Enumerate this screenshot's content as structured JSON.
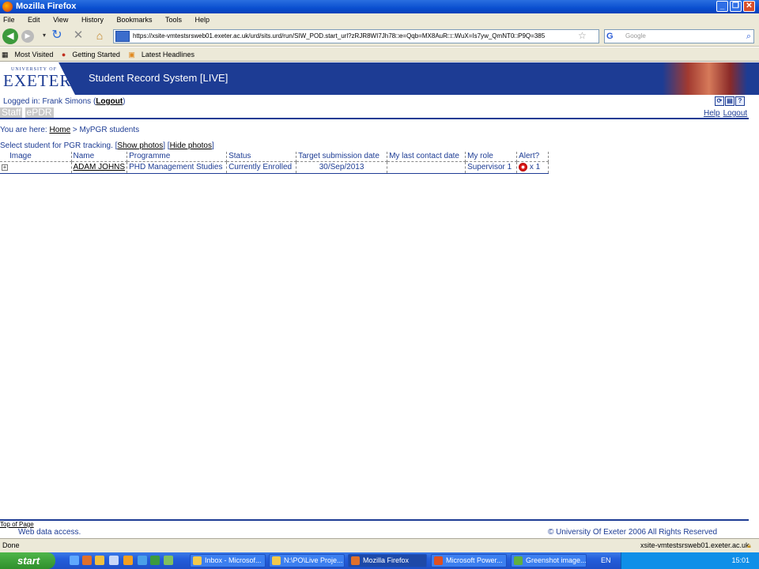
{
  "window": {
    "title": "Mozilla Firefox"
  },
  "menu": [
    "File",
    "Edit",
    "View",
    "History",
    "Bookmarks",
    "Tools",
    "Help"
  ],
  "nav": {
    "url": "https://xsite-vmtestsrsweb01.exeter.ac.uk/urd/sits.urd/run/SIW_POD.start_url?zRJR8WI7Jh78□e=Qqb=MX8AuR□□WuX=Is7yw_QmNT0□P9Q=385",
    "search_placeholder": "Google"
  },
  "bookmarks": [
    "Most Visited",
    "Getting Started",
    "Latest Headlines"
  ],
  "banner": {
    "logo_small": "UNIVERSITY OF",
    "logo_big": "EXETER",
    "system_title": "Student Record System [LIVE]"
  },
  "login": {
    "prefix": "Logged in: Frank Simons (",
    "logout": "Logout",
    "suffix": ")"
  },
  "tabs": [
    "Staff",
    "ePDR"
  ],
  "top_links": {
    "help": "Help",
    "logout": "Logout"
  },
  "breadcrumb": {
    "prefix": "You are here: ",
    "home": "Home",
    "sep": " > MyPGR students"
  },
  "select_line": {
    "text": "Select student for PGR tracking. [",
    "show": "Show photos",
    "mid": "] [",
    "hide": "Hide photos",
    "end": "]"
  },
  "table": {
    "headers": [
      "Image",
      "Name",
      "Programme",
      "Status",
      "Target submission date",
      "My last contact date",
      "My role",
      "Alert?"
    ],
    "row": {
      "expand": "+",
      "name": "ADAM JOHNS",
      "programme": "PHD Management Studies",
      "status": "Currently Enrolled",
      "target": "30/Sep/2013",
      "contact": "",
      "role": "Supervisor 1",
      "alert": "x 1"
    }
  },
  "footer": {
    "top_of_page": "Top of Page",
    "web_data": "Web data access.",
    "copyright": "© University Of Exeter 2006 All Rights Reserved"
  },
  "status": {
    "left": "Done",
    "right": "xsite-vmtestsrsweb01.exeter.ac.uk"
  },
  "taskbar": {
    "start": "start",
    "buttons": [
      "Inbox - Microsof...",
      "N:\\PO\\Live Proje...",
      "Mozilla Firefox",
      "Microsoft Power...",
      "Greenshot image..."
    ],
    "lang": "EN",
    "clock": "15:01"
  }
}
